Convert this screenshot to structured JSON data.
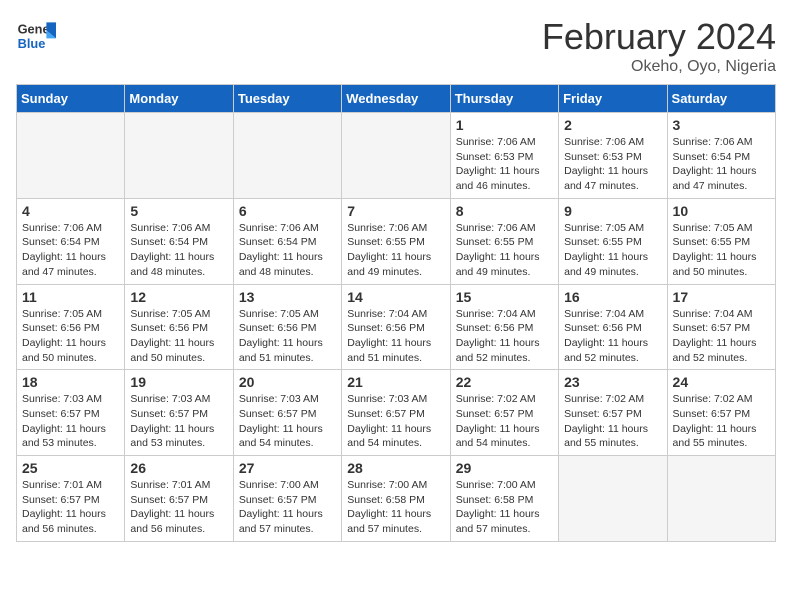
{
  "logo": {
    "general": "General",
    "blue": "Blue"
  },
  "title": "February 2024",
  "subtitle": "Okeho, Oyo, Nigeria",
  "headers": [
    "Sunday",
    "Monday",
    "Tuesday",
    "Wednesday",
    "Thursday",
    "Friday",
    "Saturday"
  ],
  "weeks": [
    [
      {
        "day": "",
        "info": ""
      },
      {
        "day": "",
        "info": ""
      },
      {
        "day": "",
        "info": ""
      },
      {
        "day": "",
        "info": ""
      },
      {
        "day": "1",
        "info": "Sunrise: 7:06 AM\nSunset: 6:53 PM\nDaylight: 11 hours\nand 46 minutes."
      },
      {
        "day": "2",
        "info": "Sunrise: 7:06 AM\nSunset: 6:53 PM\nDaylight: 11 hours\nand 47 minutes."
      },
      {
        "day": "3",
        "info": "Sunrise: 7:06 AM\nSunset: 6:54 PM\nDaylight: 11 hours\nand 47 minutes."
      }
    ],
    [
      {
        "day": "4",
        "info": "Sunrise: 7:06 AM\nSunset: 6:54 PM\nDaylight: 11 hours\nand 47 minutes."
      },
      {
        "day": "5",
        "info": "Sunrise: 7:06 AM\nSunset: 6:54 PM\nDaylight: 11 hours\nand 48 minutes."
      },
      {
        "day": "6",
        "info": "Sunrise: 7:06 AM\nSunset: 6:54 PM\nDaylight: 11 hours\nand 48 minutes."
      },
      {
        "day": "7",
        "info": "Sunrise: 7:06 AM\nSunset: 6:55 PM\nDaylight: 11 hours\nand 49 minutes."
      },
      {
        "day": "8",
        "info": "Sunrise: 7:06 AM\nSunset: 6:55 PM\nDaylight: 11 hours\nand 49 minutes."
      },
      {
        "day": "9",
        "info": "Sunrise: 7:05 AM\nSunset: 6:55 PM\nDaylight: 11 hours\nand 49 minutes."
      },
      {
        "day": "10",
        "info": "Sunrise: 7:05 AM\nSunset: 6:55 PM\nDaylight: 11 hours\nand 50 minutes."
      }
    ],
    [
      {
        "day": "11",
        "info": "Sunrise: 7:05 AM\nSunset: 6:56 PM\nDaylight: 11 hours\nand 50 minutes."
      },
      {
        "day": "12",
        "info": "Sunrise: 7:05 AM\nSunset: 6:56 PM\nDaylight: 11 hours\nand 50 minutes."
      },
      {
        "day": "13",
        "info": "Sunrise: 7:05 AM\nSunset: 6:56 PM\nDaylight: 11 hours\nand 51 minutes."
      },
      {
        "day": "14",
        "info": "Sunrise: 7:04 AM\nSunset: 6:56 PM\nDaylight: 11 hours\nand 51 minutes."
      },
      {
        "day": "15",
        "info": "Sunrise: 7:04 AM\nSunset: 6:56 PM\nDaylight: 11 hours\nand 52 minutes."
      },
      {
        "day": "16",
        "info": "Sunrise: 7:04 AM\nSunset: 6:56 PM\nDaylight: 11 hours\nand 52 minutes."
      },
      {
        "day": "17",
        "info": "Sunrise: 7:04 AM\nSunset: 6:57 PM\nDaylight: 11 hours\nand 52 minutes."
      }
    ],
    [
      {
        "day": "18",
        "info": "Sunrise: 7:03 AM\nSunset: 6:57 PM\nDaylight: 11 hours\nand 53 minutes."
      },
      {
        "day": "19",
        "info": "Sunrise: 7:03 AM\nSunset: 6:57 PM\nDaylight: 11 hours\nand 53 minutes."
      },
      {
        "day": "20",
        "info": "Sunrise: 7:03 AM\nSunset: 6:57 PM\nDaylight: 11 hours\nand 54 minutes."
      },
      {
        "day": "21",
        "info": "Sunrise: 7:03 AM\nSunset: 6:57 PM\nDaylight: 11 hours\nand 54 minutes."
      },
      {
        "day": "22",
        "info": "Sunrise: 7:02 AM\nSunset: 6:57 PM\nDaylight: 11 hours\nand 54 minutes."
      },
      {
        "day": "23",
        "info": "Sunrise: 7:02 AM\nSunset: 6:57 PM\nDaylight: 11 hours\nand 55 minutes."
      },
      {
        "day": "24",
        "info": "Sunrise: 7:02 AM\nSunset: 6:57 PM\nDaylight: 11 hours\nand 55 minutes."
      }
    ],
    [
      {
        "day": "25",
        "info": "Sunrise: 7:01 AM\nSunset: 6:57 PM\nDaylight: 11 hours\nand 56 minutes."
      },
      {
        "day": "26",
        "info": "Sunrise: 7:01 AM\nSunset: 6:57 PM\nDaylight: 11 hours\nand 56 minutes."
      },
      {
        "day": "27",
        "info": "Sunrise: 7:00 AM\nSunset: 6:57 PM\nDaylight: 11 hours\nand 57 minutes."
      },
      {
        "day": "28",
        "info": "Sunrise: 7:00 AM\nSunset: 6:58 PM\nDaylight: 11 hours\nand 57 minutes."
      },
      {
        "day": "29",
        "info": "Sunrise: 7:00 AM\nSunset: 6:58 PM\nDaylight: 11 hours\nand 57 minutes."
      },
      {
        "day": "",
        "info": ""
      },
      {
        "day": "",
        "info": ""
      }
    ]
  ]
}
